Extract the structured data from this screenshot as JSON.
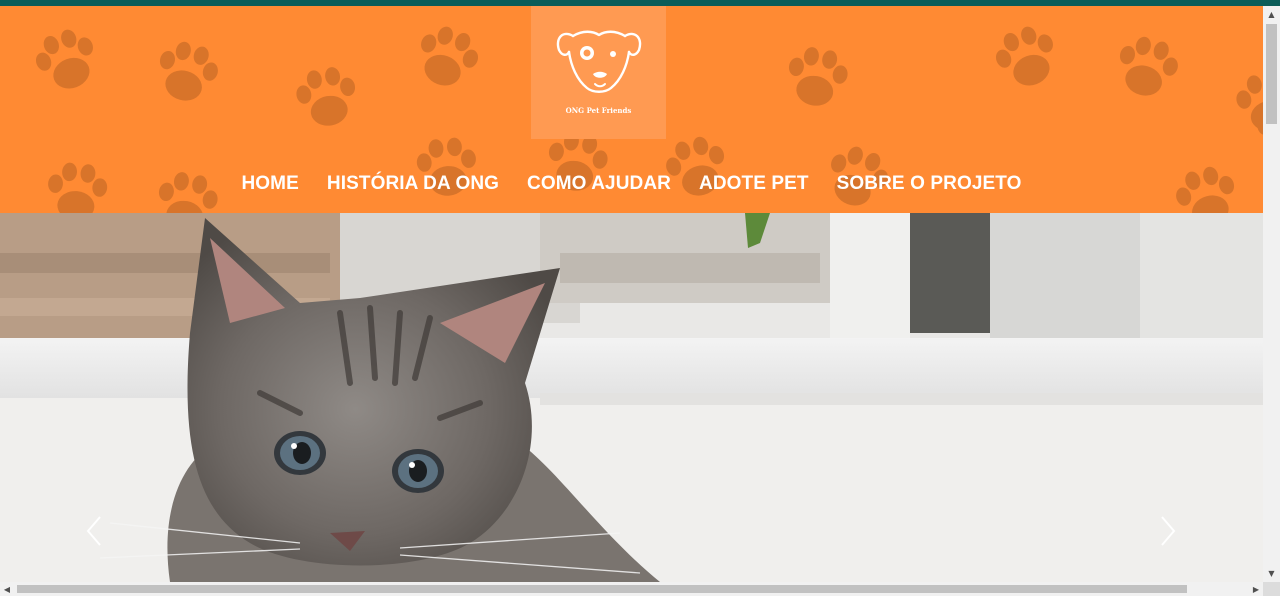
{
  "brand": {
    "logo_text": "ONG Pet Friends",
    "header_color": "#ff8a33",
    "accent_color": "#0b5d59"
  },
  "nav": {
    "items": [
      {
        "label": "HOME"
      },
      {
        "label": "HISTÓRIA DA ONG"
      },
      {
        "label": "COMO AJUDAR"
      },
      {
        "label": "ADOTE PET"
      },
      {
        "label": "SOBRE O PROJETO"
      }
    ]
  },
  "hero": {
    "image": "kitten-photo",
    "prev_icon": "chevron-left-icon",
    "next_icon": "chevron-right-icon"
  },
  "scrollbars": {
    "up_icon": "▲",
    "down_icon": "▼",
    "left_icon": "◀",
    "right_icon": "▶"
  }
}
